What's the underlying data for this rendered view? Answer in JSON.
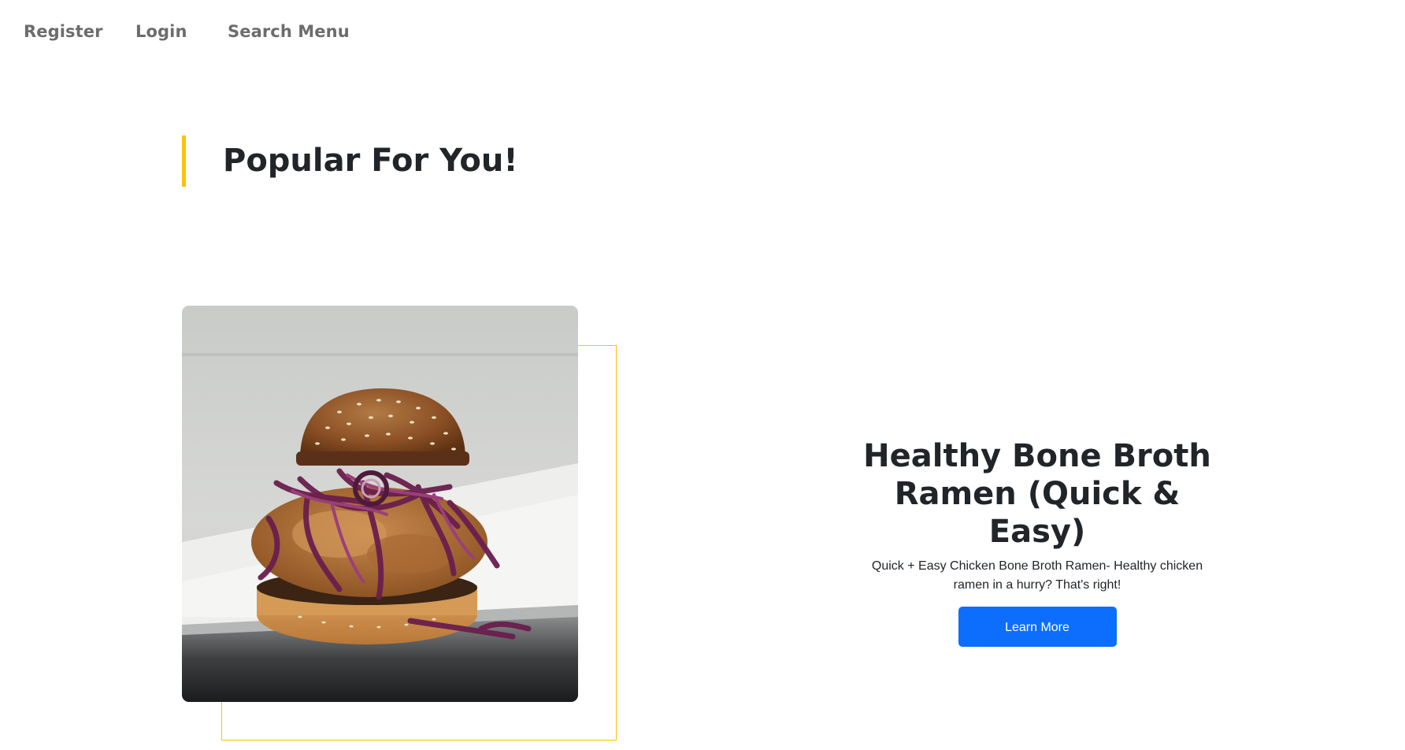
{
  "nav": {
    "register": "Register",
    "login": "Login",
    "search_menu": "Search Menu"
  },
  "section": {
    "title": "Popular For You!"
  },
  "feature": {
    "title": "Healthy Bone Broth Ramen (Quick & Easy)",
    "description": "Quick + Easy Chicken Bone Broth Ramen- Healthy chicken ramen in a hurry? That's right!",
    "button_label": "Learn More"
  },
  "colors": {
    "accent": "#ffc107",
    "button": "#0d6efd",
    "text": "#212529",
    "nav_text": "#6c6c6c"
  },
  "image": {
    "subject": "fried chicken burger with purple slaw"
  }
}
